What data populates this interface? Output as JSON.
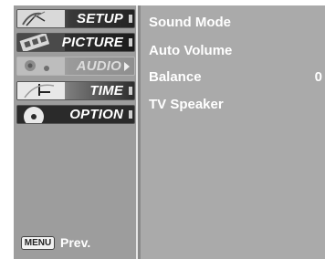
{
  "sidebar": {
    "items": [
      {
        "label": "SETUP",
        "icon": "satellite-dish-icon",
        "active": true
      },
      {
        "label": "PICTURE",
        "icon": "film-reel-icon",
        "active": true
      },
      {
        "label": "AUDIO",
        "icon": "speaker-icon",
        "active": false,
        "selected": true
      },
      {
        "label": "TIME",
        "icon": "clock-icon",
        "active": true
      },
      {
        "label": "OPTION",
        "icon": "option-disc-icon",
        "active": true
      }
    ]
  },
  "footer": {
    "key": "MENU",
    "label": "Prev."
  },
  "audio_menu": {
    "rows": [
      {
        "label": "Sound Mode",
        "value": ""
      },
      {
        "label": "Auto Volume",
        "value": ""
      },
      {
        "label": "Balance",
        "value": "0"
      },
      {
        "label": "TV Speaker",
        "value": ""
      }
    ]
  },
  "colors": {
    "panel": "#aaaaaa",
    "sidebar": "#9d9d9d",
    "text": "#ffffff"
  }
}
